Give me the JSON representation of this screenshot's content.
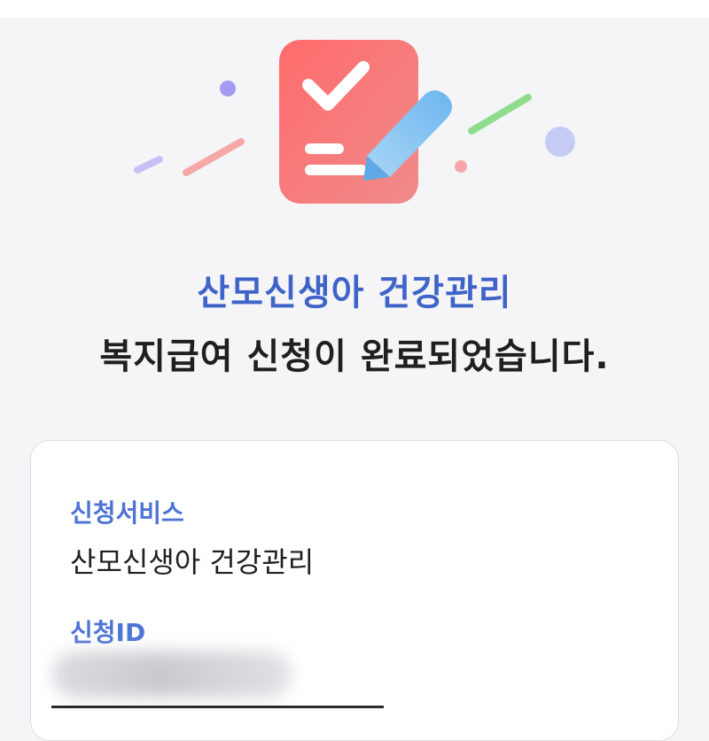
{
  "header": {
    "service_name": "산모신생아 건강관리",
    "completion_message": "복지급여 신청이 완료되었습니다."
  },
  "hero_icon": "checklist-with-pen-icon",
  "result_card": {
    "service_label": "신청서비스",
    "service_value": "산모신생아 건강관리",
    "id_label": "신청ID"
  },
  "colors": {
    "accent_blue": "#3f63c8",
    "label_blue": "#4d73d6",
    "icon_red": "#f26e6e",
    "pen_blue": "#8cc8f2",
    "background": "#f5f5f7"
  }
}
